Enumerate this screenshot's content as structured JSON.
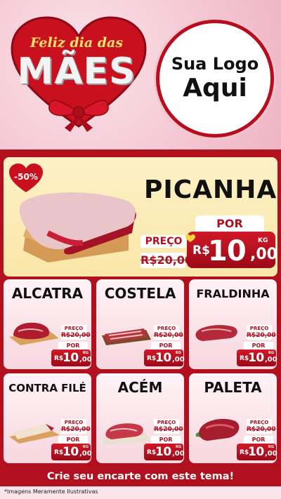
{
  "header": {
    "line1": "Feliz dia das",
    "line2": "MÃES",
    "logo_line1": "Sua Logo",
    "logo_line2": "Aqui"
  },
  "featured": {
    "badge": "-50%",
    "name": "PICANHA",
    "por_label": "POR",
    "preco_label": "PREÇO",
    "old_price": "R$20,00",
    "currency": "R$",
    "price_int": "10",
    "price_cents": ",00",
    "unit": "KG"
  },
  "products": [
    {
      "name": "ALCATRA",
      "preco_label": "PREÇO",
      "old_price": "R$20,00",
      "por_label": "POR",
      "currency": "R$",
      "price_int": "10",
      "price_cents": ",00",
      "unit": "KG"
    },
    {
      "name": "COSTELA",
      "preco_label": "PREÇO",
      "old_price": "R$20,00",
      "por_label": "POR",
      "currency": "R$",
      "price_int": "10",
      "price_cents": ",00",
      "unit": "KG"
    },
    {
      "name": "FRALDINHA",
      "preco_label": "PREÇO",
      "old_price": "R$20,00",
      "por_label": "POR",
      "currency": "R$",
      "price_int": "10",
      "price_cents": ",00",
      "unit": "KG"
    },
    {
      "name": "CONTRA FILÉ",
      "preco_label": "PREÇO",
      "old_price": "R$20,00",
      "por_label": "POR",
      "currency": "R$",
      "price_int": "10",
      "price_cents": ",00",
      "unit": "KG"
    },
    {
      "name": "ACÉM",
      "preco_label": "PREÇO",
      "old_price": "R$20,00",
      "por_label": "POR",
      "currency": "R$",
      "price_int": "10",
      "price_cents": ",00",
      "unit": "KG"
    },
    {
      "name": "PALETA",
      "preco_label": "PREÇO",
      "old_price": "R$20,00",
      "por_label": "POR",
      "currency": "R$",
      "price_int": "10",
      "price_cents": ",00",
      "unit": "KG"
    }
  ],
  "cta": "Crie seu encarte com este tema!",
  "disclaimer": "*Imagens Meramente Ilustrativas",
  "colors": {
    "accent": "#b1101e",
    "card_bg": "#fff3f6",
    "featured_bg": "#fdf1c6",
    "header_bg": "#f4c6d2"
  }
}
